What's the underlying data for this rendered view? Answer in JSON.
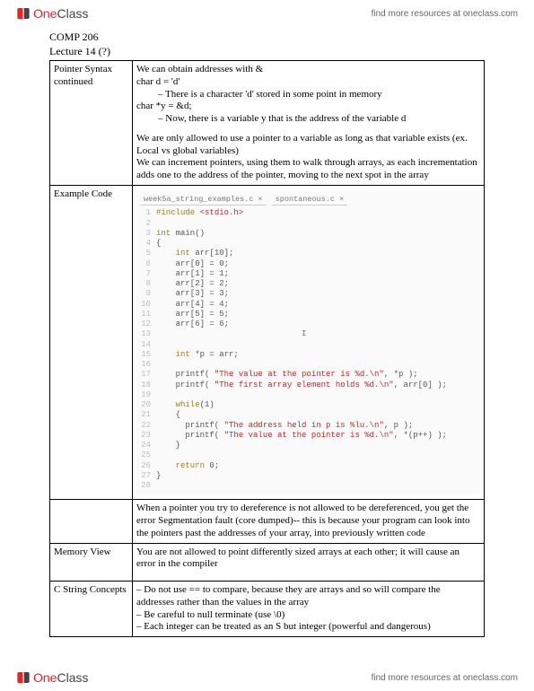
{
  "brand": {
    "one": "One",
    "class": "Class",
    "tagline": "find more resources at oneclass.com"
  },
  "course": "COMP 206",
  "lecture": "Lecture 14 (?)",
  "rows": {
    "r1": {
      "left1": "Pointer Syntax",
      "left2": "continued",
      "p1": "We can obtain addresses with &",
      "p2": "char d = 'd'",
      "p3": "– There is a character 'd' stored in some point in memory",
      "p4": "char *y = &d;",
      "p5": "– Now, there is a variable y that is the address of the variable d",
      "p6": "We are only allowed to use a pointer to a variable as long as that variable exists (ex. Local vs global variables)",
      "p7": "We can increment pointers, using them to walk through arrays, as each incrementation adds one to the address of the pointer, moving to the next spot in the array"
    },
    "r2": {
      "left": "Example Code",
      "tab1": "week5a_string_examples.c",
      "tab2": "spontaneous.c",
      "code": [
        {
          "n": "1",
          "t": "#include <stdio.h>",
          "cls": "pp"
        },
        {
          "n": "2",
          "t": ""
        },
        {
          "n": "3",
          "t": "int main()"
        },
        {
          "n": "4",
          "t": "{"
        },
        {
          "n": "5",
          "t": "    int arr[10];"
        },
        {
          "n": "6",
          "t": "    arr[0] = 0;"
        },
        {
          "n": "7",
          "t": "    arr[1] = 1;"
        },
        {
          "n": "8",
          "t": "    arr[2] = 2;"
        },
        {
          "n": "9",
          "t": "    arr[3] = 3;"
        },
        {
          "n": "10",
          "t": "    arr[4] = 4;"
        },
        {
          "n": "11",
          "t": "    arr[5] = 5;"
        },
        {
          "n": "12",
          "t": "    arr[6] = 6;"
        },
        {
          "n": "13",
          "t": "                              I",
          "cls": "cursor-caret"
        },
        {
          "n": "14",
          "t": ""
        },
        {
          "n": "15",
          "t": "    int *p = arr;"
        },
        {
          "n": "16",
          "t": ""
        },
        {
          "n": "17",
          "t": "    printf( \"The value at the pointer is %d.\\n\", *p );"
        },
        {
          "n": "18",
          "t": "    printf( \"The first array element holds %d.\\n\", arr[0] );"
        },
        {
          "n": "19",
          "t": ""
        },
        {
          "n": "20",
          "t": "    while(1)"
        },
        {
          "n": "21",
          "t": "    {"
        },
        {
          "n": "22",
          "t": "      printf( \"The address held in p is %lu.\\n\", p );"
        },
        {
          "n": "23",
          "t": "      printf( \"The value at the pointer is %d.\\n\", *(p++) );"
        },
        {
          "n": "24",
          "t": "    }"
        },
        {
          "n": "25",
          "t": ""
        },
        {
          "n": "26",
          "t": "    return 0;"
        },
        {
          "n": "27",
          "t": "}"
        },
        {
          "n": "28",
          "t": ""
        }
      ]
    },
    "r3": {
      "left": "",
      "body": "When a pointer you try to dereference is not allowed to be dereferenced, you get the error Segmentation fault (core dumped)-- this is because your program can look into the pointers past the addresses of your array, into previously written code"
    },
    "r4": {
      "left": "Memory View",
      "body": "You are not allowed to point differently sized arrays at each other; it will cause an error in the compiler"
    },
    "r5": {
      "left": "C String Concepts",
      "l1": "– Do not use == to compare, because they are arrays and so will compare the addresses rather than the values in the array",
      "l2": "– Be careful to null terminate (use \\0)",
      "l3": "– Each integer can be treated as an S but integer (powerful and dangerous)"
    }
  }
}
